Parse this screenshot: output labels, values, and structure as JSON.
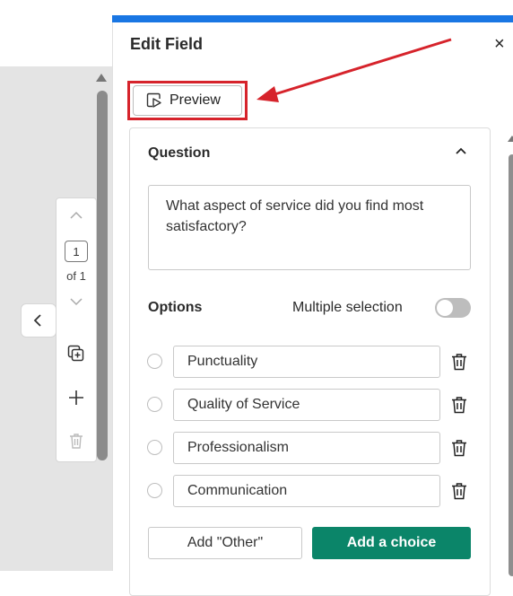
{
  "panel": {
    "title": "Edit Field",
    "close_glyph": "×",
    "preview_label": "Preview"
  },
  "page_nav": {
    "current_page": "1",
    "of_label": "of 1"
  },
  "question": {
    "section_title": "Question",
    "text": "What aspect of service did you find most satisfactory?"
  },
  "options": {
    "section_title": "Options",
    "multiple_selection_label": "Multiple selection",
    "multiple_selection_enabled": false,
    "items": [
      {
        "label": "Punctuality"
      },
      {
        "label": "Quality of Service"
      },
      {
        "label": "Professionalism"
      },
      {
        "label": "Communication"
      }
    ],
    "add_other_label": "Add \"Other\"",
    "add_choice_label": "Add a choice"
  },
  "colors": {
    "accent_blue": "#1976e3",
    "primary_green": "#0b8569",
    "highlight_red": "#d6232b"
  },
  "icons": [
    "chevron-left-icon",
    "chevron-up-icon",
    "chevron-down-icon",
    "duplicate-icon",
    "plus-icon",
    "trash-icon",
    "preview-icon",
    "close-icon"
  ]
}
